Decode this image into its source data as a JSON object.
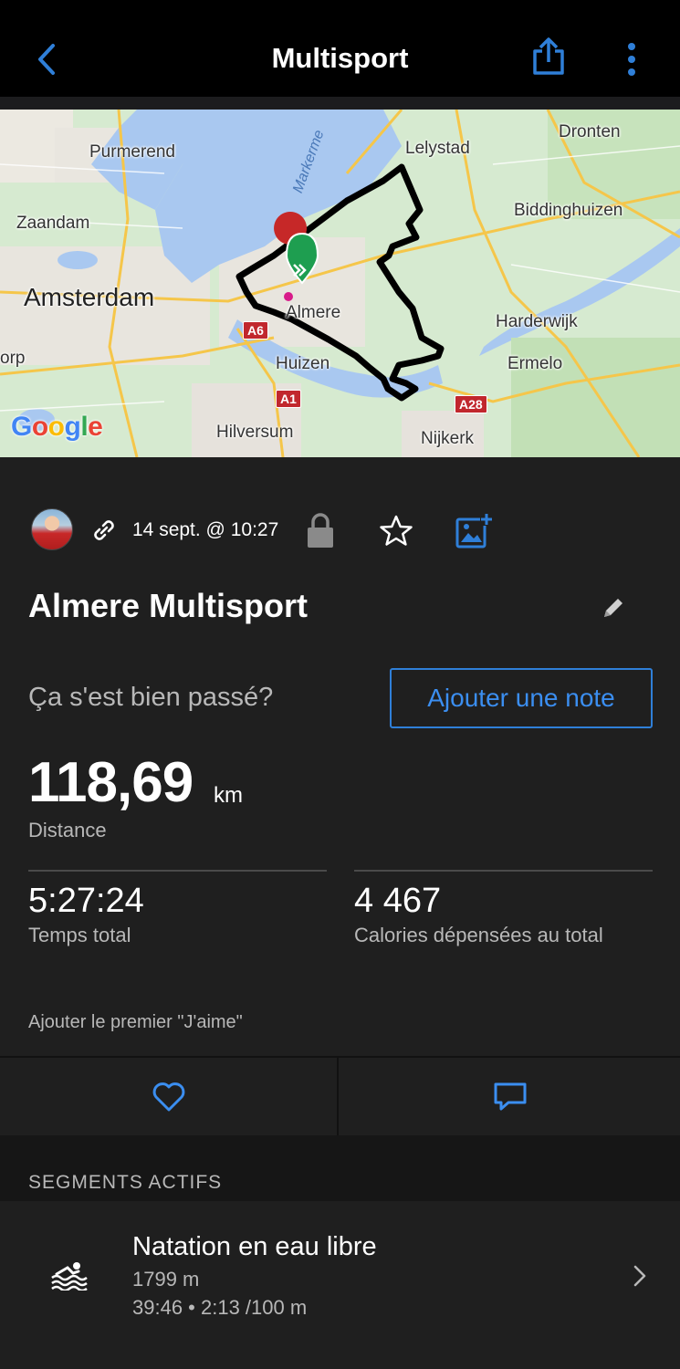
{
  "header": {
    "title": "Multisport",
    "back_icon": "chevron-left-icon",
    "share_icon": "share-icon",
    "more_icon": "more-vertical-icon",
    "accent_color": "#2f7fd8"
  },
  "map": {
    "labels": {
      "purmerend": "Purmerend",
      "lelystad": "Lelystad",
      "dronten": "Dronten",
      "zaandam": "Zaandam",
      "biddinghuizen": "Biddinghuizen",
      "amsterdam": "Amsterdam",
      "almere": "Almere",
      "harderwijk": "Harderwijk",
      "huizen": "Huizen",
      "ermelo": "Ermelo",
      "orp": "orp",
      "hilversum": "Hilversum",
      "nijkerk": "Nijkerk",
      "markermeer": "Markerme"
    },
    "roads": {
      "a6": "A6",
      "a1": "A1",
      "a28": "A28"
    },
    "attribution": "Google"
  },
  "activity": {
    "date": "14 sept. @ 10:27",
    "title": "Almere Multisport",
    "question": "Ça s'est bien passé?",
    "add_note_label": "Ajouter une note"
  },
  "stats": {
    "distance_value": "118,69",
    "distance_unit": "km",
    "distance_label": "Distance",
    "total_time_value": "5:27:24",
    "total_time_label": "Temps total",
    "calories_value": "4 467",
    "calories_label": "Calories dépensées au total"
  },
  "social": {
    "like_prompt": "Ajouter le premier \"J'aime\""
  },
  "segments": {
    "header": "SEGMENTS ACTIFS",
    "items": [
      {
        "name": "Natation en eau libre",
        "distance": "1799 m",
        "time_pace": "39:46 • 2:13 /100 m",
        "icon": "swim-icon"
      }
    ]
  }
}
